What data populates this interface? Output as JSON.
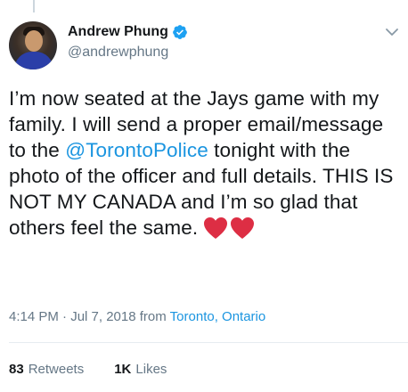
{
  "tweet": {
    "author": {
      "display_name": "Andrew Phung",
      "handle": "@andrewphung",
      "verified": true,
      "avatar_icon": "profile-photo"
    },
    "text_before_mention": "I’m now seated at the Jays game with my family. I will send a proper email/message to the ",
    "mention": "@TorontoPolice",
    "text_after_mention": " tonight with the photo of the officer and full details. THIS IS NOT MY CANADA and I’m so glad that others feel the same.",
    "emoji": [
      "red-heart",
      "red-heart"
    ],
    "timestamp": "4:14 PM · Jul 7, 2018",
    "location_prefix": "from",
    "location": "Toronto, Ontario",
    "stats": {
      "retweets_count": "83",
      "retweets_label": "Retweets",
      "likes_count": "1K",
      "likes_label": "Likes"
    }
  },
  "colors": {
    "link": "#1b95e0",
    "secondary_text": "#657786",
    "primary_text": "#14171a",
    "verified_badge": "#1da1f2",
    "heart": "#dd2e44"
  },
  "icons": {
    "verified": "verified-badge-icon",
    "menu": "chevron-down-icon"
  }
}
